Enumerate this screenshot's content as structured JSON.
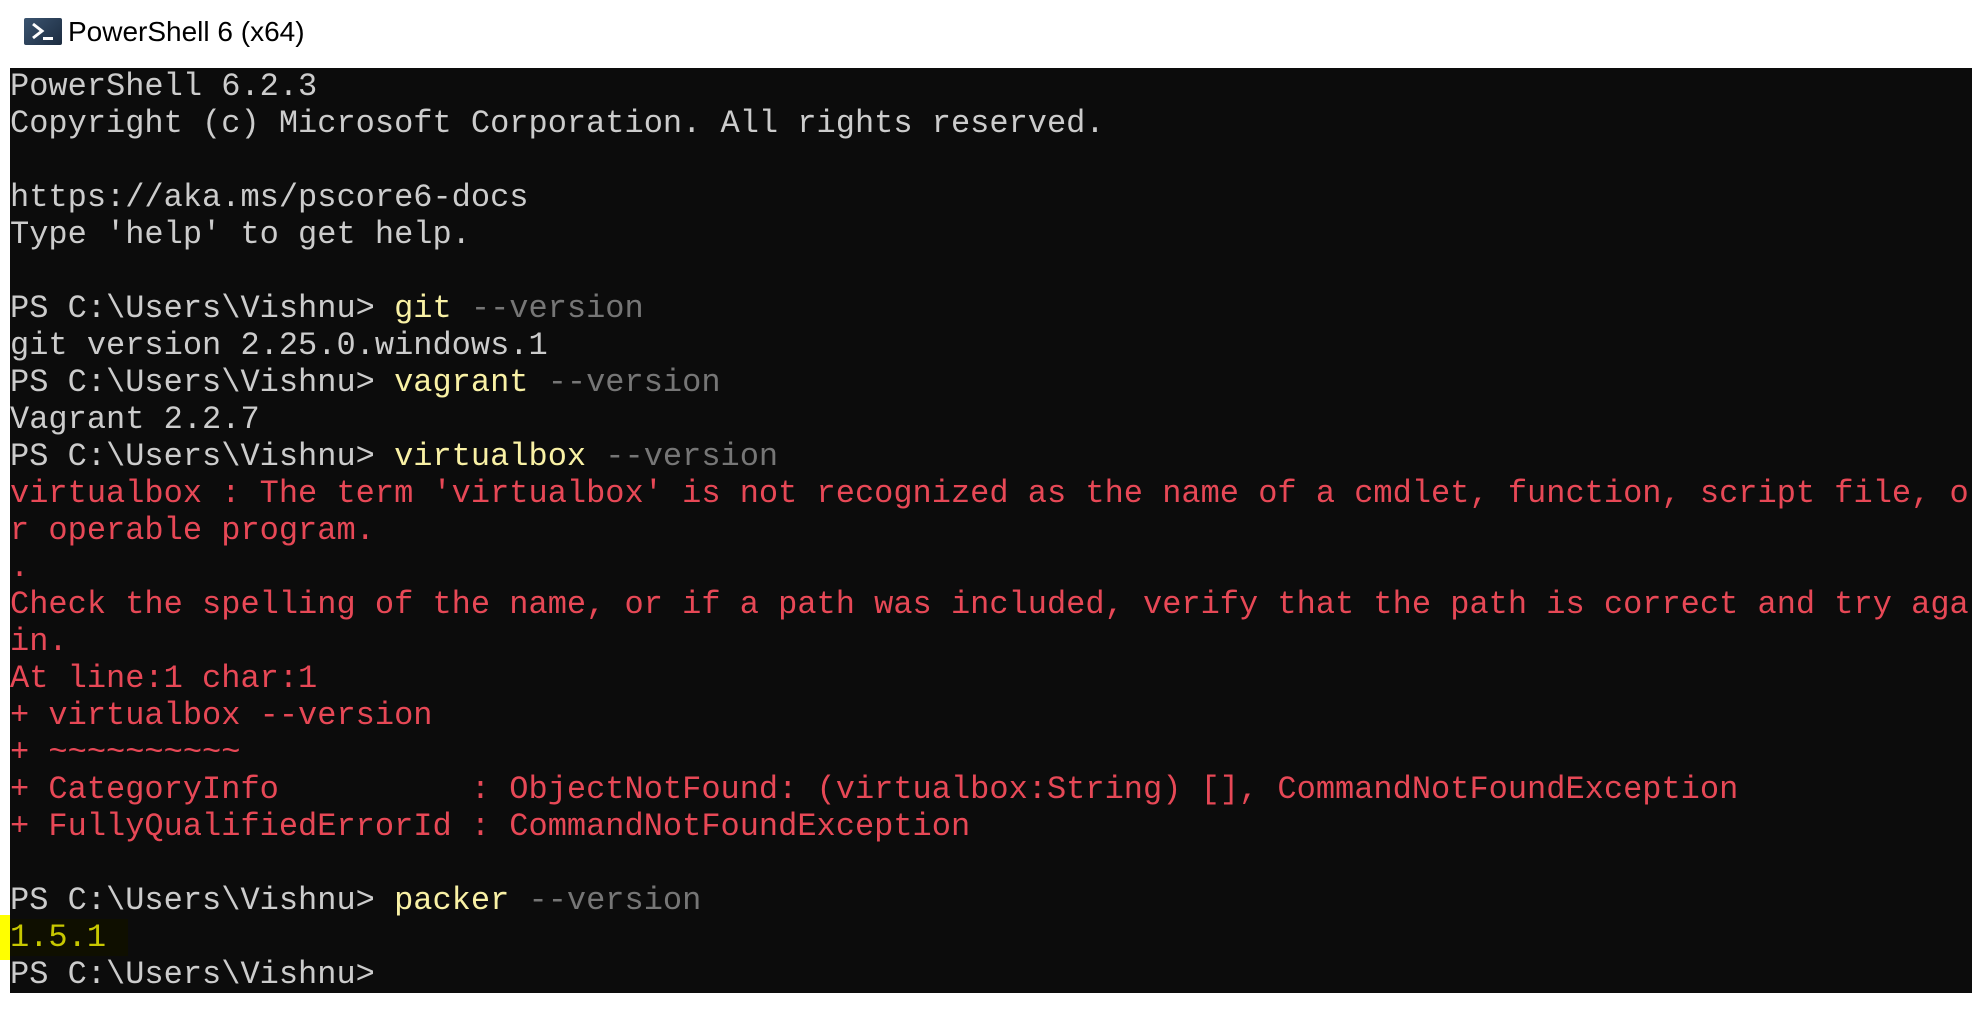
{
  "window": {
    "title": "PowerShell 6 (x64)",
    "icon": "powershell-icon"
  },
  "console": {
    "prompt": "PS C:\\Users\\Vishnu> ",
    "banner": [
      "PowerShell 6.2.3",
      "Copyright (c) Microsoft Corporation. All rights reserved.",
      "",
      "https://aka.ms/pscore6-docs",
      "Type 'help' to get help."
    ],
    "git": {
      "cmd": "git",
      "param": " --version",
      "output": "git version 2.25.0.windows.1"
    },
    "vagrant": {
      "cmd": "vagrant",
      "param": " --version",
      "output": "Vagrant 2.2.7"
    },
    "virtualbox": {
      "cmd": "virtualbox",
      "param": " --version",
      "errors": [
        "virtualbox : The term 'virtualbox' is not recognized as the name of a cmdlet, function, script file, or operable program.",
        ".",
        "Check the spelling of the name, or if a path was included, verify that the path is correct and try again.",
        "At line:1 char:1",
        "+ virtualbox --version",
        "+ ~~~~~~~~~~",
        "+ CategoryInfo          : ObjectNotFound: (virtualbox:String) [], CommandNotFoundException",
        "+ FullyQualifiedErrorId : CommandNotFoundException"
      ]
    },
    "packer": {
      "cmd": "packer",
      "param": " --version",
      "output": "1.5.1"
    }
  },
  "colors": {
    "background": "#0c0c0c",
    "foreground": "#cccccc",
    "command": "#f9f1a5",
    "parameter": "#767676",
    "error": "#e74856",
    "highlight": "#ffff00"
  }
}
